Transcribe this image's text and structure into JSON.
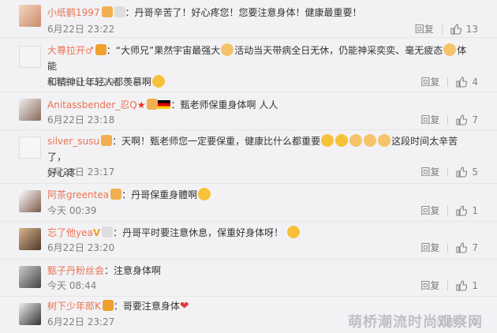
{
  "colors": {
    "username": "#eb7350",
    "meta": "#808080",
    "heart": "#e03c3c"
  },
  "comments": [
    {
      "user": "小纸鹤1997",
      "text": "：丹哥辛苦了！好心疼您！您要注意身体！健康最重要！",
      "time": "6月22日 23:22",
      "reply": "回复",
      "likes": "13"
    },
    {
      "user": "大尊拉开♂",
      "text1": "：“大师兄”果然宇宙最强大",
      "text2": "活动当天带病全日无休，仍能神采奕奕、毫无疲态",
      "text3": "体能",
      "text4": "和精神让年轻人都羡慕啊",
      "time": "6月22日 23:29",
      "reply": "回复",
      "likes": "4"
    },
    {
      "user": "Anitassbender_忍Q",
      "text": "：甄老师保重身体啊",
      "glyph": "人人",
      "time": "6月22日 23:18",
      "reply": "回复",
      "likes": "7"
    },
    {
      "user": "silver_susu",
      "text1": "：天啊！甄老师您一定要保重，健康比什么都重要",
      "text2": "这段时间太辛苦了，",
      "text3": "好心疼",
      "time": "6月22日 23:17",
      "reply": "回复",
      "likes": "5"
    },
    {
      "user": "阿茶greentea",
      "text": "：丹哥保重身體啊",
      "time": "今天 00:39",
      "reply": "回复",
      "likes": "1"
    },
    {
      "user": "忘了他yea",
      "text": "：丹哥平时要注意休息，保重好身体呀！",
      "time": "6月22日 23:20",
      "reply": "回复",
      "likes": "7"
    },
    {
      "user": "甄子丹粉丝会",
      "text": "：注意身体啊",
      "time": "今天 08:44",
      "reply": "回复",
      "likes": "1"
    },
    {
      "user": "树下少年郎K",
      "text": "：哥要注意身体",
      "time": "6月22日 23:27",
      "reply": "回复",
      "likes": "1"
    }
  ],
  "watermark": "萌桥潮流时尚观察网"
}
